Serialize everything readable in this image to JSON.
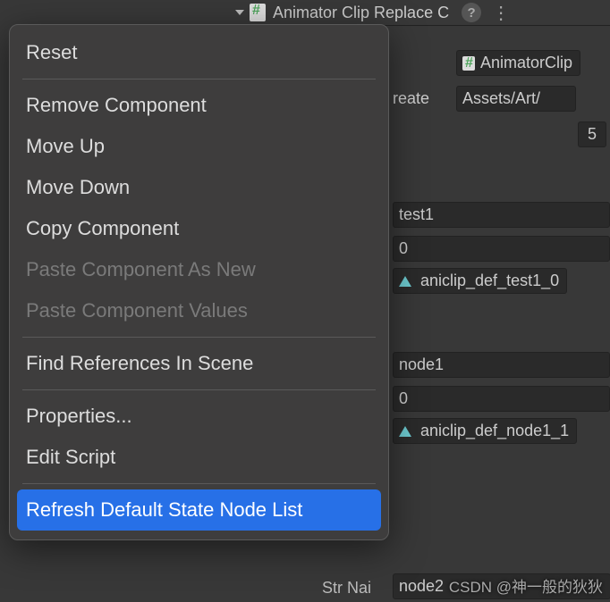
{
  "header": {
    "title": "Animator Clip Replace C"
  },
  "inspector": {
    "script_label": "AnimatorClip",
    "create_lbl": "reate",
    "create_path": "Assets/Art/",
    "count": "5",
    "row1_name": "test1",
    "row1_num": "0",
    "row1_clip": "aniclip_def_test1_0",
    "row2_name": "node1",
    "row2_num": "0",
    "row2_clip": "aniclip_def_node1_1",
    "str_name_lbl": "Str Nai",
    "str_name_val": "node2"
  },
  "menu": {
    "reset": "Reset",
    "remove": "Remove Component",
    "moveup": "Move Up",
    "movedown": "Move Down",
    "copy": "Copy Component",
    "paste_new": "Paste Component As New",
    "paste_vals": "Paste Component Values",
    "findref": "Find References In Scene",
    "props": "Properties...",
    "editscript": "Edit Script",
    "refresh": "Refresh Default State Node List"
  },
  "watermark": "CSDN @神一般的狄狄"
}
